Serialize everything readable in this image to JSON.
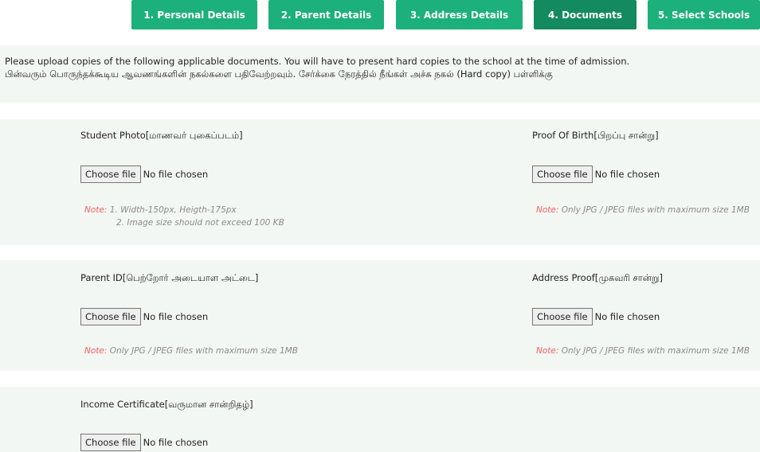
{
  "steps": [
    {
      "label": "1. Personal Details",
      "active": false
    },
    {
      "label": "2. Parent Details",
      "active": false
    },
    {
      "label": "3. Address Details",
      "active": false
    },
    {
      "label": "4. Documents",
      "active": true
    },
    {
      "label": "5. Select Schools",
      "active": false
    }
  ],
  "notice": {
    "line_en": "Please upload copies of the following applicable documents. You will have to present hard copies to the school at the time of admission.",
    "line_ta": "பின்வரும் பொருந்தக்கூடிய ஆவணங்களின் நகல்களை பதிவேற்றவும். சேர்க்கை நேரத்தில் நீங்கள் அச்சு நகல் (Hard copy) பள்ளிக்கு"
  },
  "file_input": {
    "button_label": "Choose file",
    "no_file_text": "No file chosen"
  },
  "note_label": "Note:",
  "documents": {
    "student_photo": {
      "label": "Student Photo[மாணவர் புகைப்படம்]",
      "note_line1": " 1. Width-150px, Heigth-175px",
      "note_line2": "2. Image size should not exceed 100 KB"
    },
    "proof_of_birth": {
      "label": "Proof Of Birth[பிறப்பு சான்று]",
      "note": " Only JPG / JPEG files with maximum size 1MB"
    },
    "parent_id": {
      "label": "Parent ID[பெற்றோர் அடையாள அட்டை]",
      "note": " Only JPG / JPEG files with maximum size 1MB"
    },
    "address_proof": {
      "label": "Address Proof[முகவரி சான்று]",
      "note": " Only JPG / JPEG files with maximum size 1MB"
    },
    "income_certificate": {
      "label": "Income Certificate[வருமான சான்றிதழ்]"
    }
  },
  "colors": {
    "step_bg": "#1bb07c",
    "step_active_bg": "#138a5f",
    "section_bg": "#f3f7f3",
    "note_label": "#f26060"
  }
}
